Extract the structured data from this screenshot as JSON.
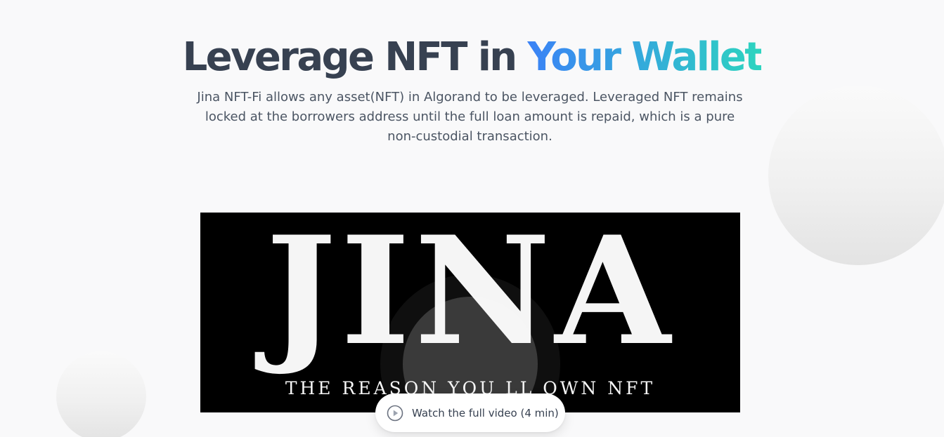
{
  "hero": {
    "title_main": "Leverage NFT in ",
    "title_highlight": "Your Wallet",
    "description": "Jina NFT-Fi allows any asset(NFT) in Algorand to be leveraged. Leveraged NFT remains locked at the borrowers address until the full loan amount is repaid, which is a pure non-custodial transaction."
  },
  "video": {
    "logo_text": "JINA",
    "tagline": "THE REASON YOU LL OWN NFT",
    "watch_label": "Watch the full video (4 min)",
    "watch_icon": "play-circle-icon"
  },
  "colors": {
    "title": "#374151",
    "gradient_start": "#3b82f6",
    "gradient_end": "#2dd4bf",
    "text": "#4b5563",
    "background": "#f9f9fa"
  }
}
